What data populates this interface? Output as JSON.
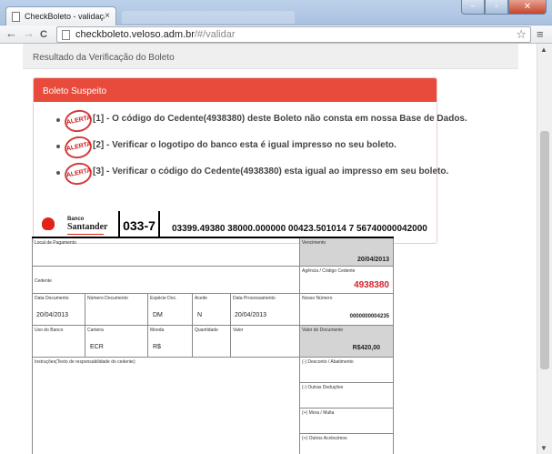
{
  "browser": {
    "tab_title": "CheckBoleto - validação d",
    "tab_close": "×",
    "url_host": "checkboleto.veloso.adm.br",
    "url_path": "/#/validar",
    "back": "←",
    "forward": "→",
    "reload": "C",
    "star": "☆",
    "menu": "≡",
    "win_min": "−",
    "win_max": "▫",
    "win_close": "✕"
  },
  "page": {
    "result_header": "Resultado da Verificação do Boleto",
    "panel_title": "Boleto Suspeito",
    "stamp_label": "ALERTA",
    "alerts": [
      "[1] - O código do Cedente(4938380) deste Boleto não consta em nossa Base de Dados.",
      "[2] - Verificar o logotipo do banco esta é igual impresso no seu boleto.",
      "[3] - Verificar o código do Cedente(4938380) esta igual ao impresso em seu boleto."
    ]
  },
  "boleto": {
    "bank_small": "Banco",
    "bank_name": "Santander",
    "bank_code": "033-7",
    "digitable_line": "03399.49380 38000.000000 00423.501014 7 56740000042000",
    "local_pagamento_label": "Local de Pagamento",
    "vencimento_label": "Vencimento",
    "vencimento": "20/04/2013",
    "cedente_label": "Cedente",
    "agencia_label": "Agência / Código Cedente",
    "agencia": "4938380",
    "data_documento_label": "Data Documento",
    "data_documento": "20/04/2013",
    "numero_documento_label": "Número Documento",
    "especie_doc_label": "Espécie Doc.",
    "especie_doc": "DM",
    "aceite_label": "Aceite",
    "aceite": "N",
    "data_processamento_label": "Data Processamento",
    "data_processamento": "20/04/2013",
    "nosso_numero_label": "Nosso Número",
    "nosso_numero": "0000000004235",
    "uso_banco_label": "Uso do Banco",
    "carteira_label": "Carteira",
    "carteira": "ECR",
    "moeda_label": "Moeda",
    "moeda": "R$",
    "quantidade_label": "Quantidade",
    "valor_label": "Valor",
    "valor_documento_label": "Valor do Documento",
    "valor_documento": "R$420,00",
    "instrucoes_label": "Instruções(Texto de responsabilidade do cedente)",
    "desconto_label": "(-) Desconto / Abatimento",
    "outras_deducoes_label": "(-) Outras Deduções",
    "mora_label": "(+) Mora / Multa",
    "outros_acrescimos_label": "(+) Outros Acréscimos"
  }
}
